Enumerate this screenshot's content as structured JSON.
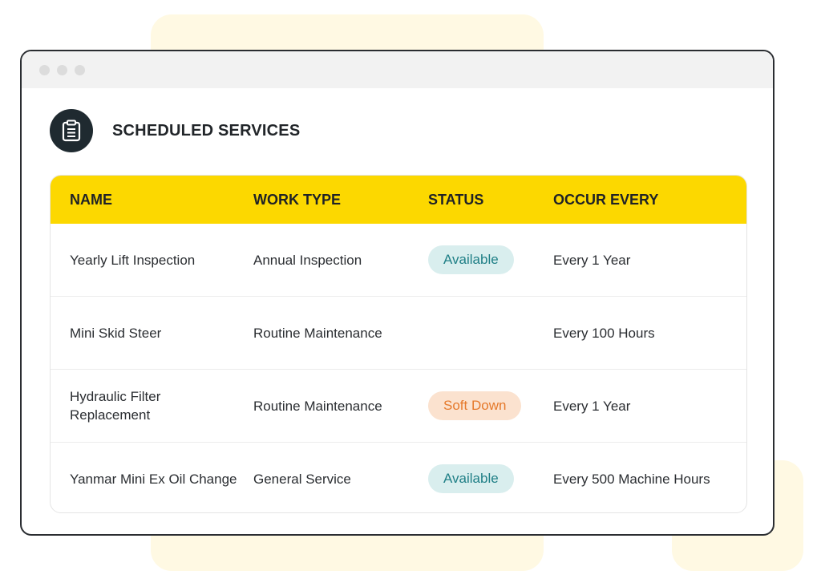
{
  "header": {
    "title": "SCHEDULED SERVICES",
    "icon": "clipboard-icon"
  },
  "table": {
    "columns": [
      "NAME",
      "WORK TYPE",
      "STATUS",
      "OCCUR EVERY"
    ],
    "rows": [
      {
        "name": "Yearly Lift Inspection",
        "work_type": "Annual Inspection",
        "status": "Available",
        "occur_every": "Every 1 Year"
      },
      {
        "name": "Mini Skid Steer",
        "work_type": "Routine Maintenance",
        "status": "",
        "occur_every": "Every 100 Hours"
      },
      {
        "name": "Hydraulic Filter Replacement",
        "work_type": "Routine Maintenance",
        "status": "Soft Down",
        "occur_every": "Every 1 Year"
      },
      {
        "name": "Yanmar Mini Ex Oil Change",
        "work_type": "General Service",
        "status": "Available",
        "occur_every": "Every 500 Machine Hours"
      }
    ]
  },
  "colors": {
    "accent": "#fcd800",
    "available_bg": "#d9eeee",
    "available_text": "#1f7f86",
    "softdown_bg": "#fbe2cf",
    "softdown_text": "#e5792b"
  }
}
